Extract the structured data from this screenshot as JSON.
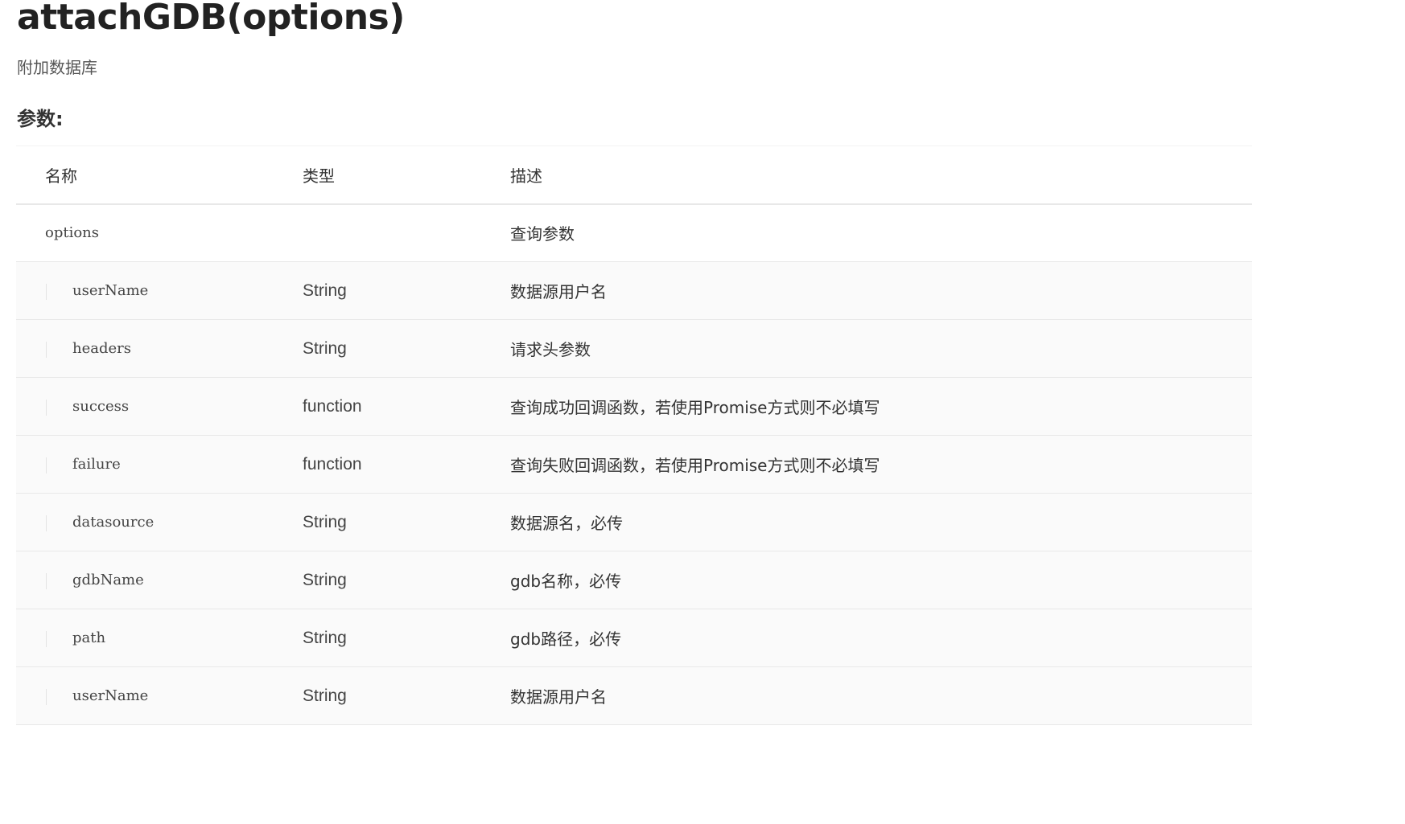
{
  "page": {
    "title": "attachGDB(options)",
    "subtitle": "附加数据库",
    "params_heading": "参数:"
  },
  "table": {
    "headers": {
      "name": "名称",
      "type": "类型",
      "desc": "描述"
    },
    "rows": [
      {
        "name": "options",
        "type": "",
        "desc": "查询参数",
        "level": 0
      },
      {
        "name": "userName",
        "type": "String",
        "desc": "数据源用户名",
        "level": 1
      },
      {
        "name": "headers",
        "type": "String",
        "desc": "请求头参数",
        "level": 1
      },
      {
        "name": "success",
        "type": "function",
        "desc": "查询成功回调函数，若使用Promise方式则不必填写",
        "level": 1
      },
      {
        "name": "failure",
        "type": "function",
        "desc": "查询失败回调函数，若使用Promise方式则不必填写",
        "level": 1
      },
      {
        "name": "datasource",
        "type": "String",
        "desc": "数据源名，必传",
        "level": 1
      },
      {
        "name": "gdbName",
        "type": "String",
        "desc": "gdb名称，必传",
        "level": 1
      },
      {
        "name": "path",
        "type": "String",
        "desc": "gdb路径，必传",
        "level": 1
      },
      {
        "name": "userName",
        "type": "String",
        "desc": "数据源用户名",
        "level": 1
      }
    ]
  }
}
